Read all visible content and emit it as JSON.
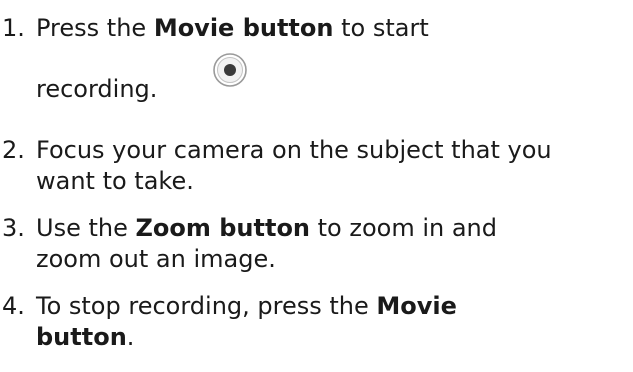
{
  "steps": [
    {
      "number": "1.",
      "line1_a": "Press the ",
      "line1_bold": "Movie button",
      "line1_b": " to start",
      "line2": "recording.",
      "icon": "record-button-icon"
    },
    {
      "number": "2.",
      "line1": "Focus your camera on the subject that you",
      "line2": "want to take."
    },
    {
      "number": "3.",
      "line1_a": "Use the ",
      "line1_bold": "Zoom button",
      "line1_b": " to zoom in and",
      "line2": "zoom out an image."
    },
    {
      "number": "4.",
      "line1_a": "To stop recording, press the ",
      "line1_bold": "Movie",
      "line2_bold": "button",
      "line2_b": "."
    }
  ]
}
